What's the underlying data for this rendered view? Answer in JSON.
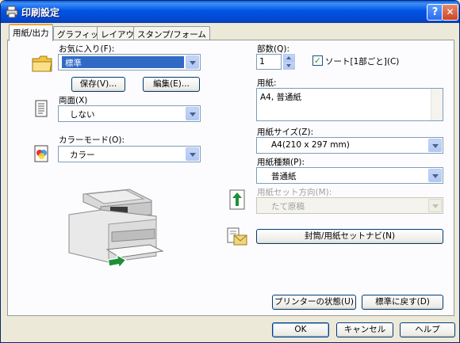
{
  "window": {
    "title": "印刷設定",
    "help": "?",
    "close": "✕"
  },
  "tabs": [
    {
      "label": "用紙/出力",
      "active": true
    },
    {
      "label": "グラフィックス",
      "active": false
    },
    {
      "label": "レイアウト",
      "active": false
    },
    {
      "label": "スタンプ/フォーム",
      "active": false
    }
  ],
  "left": {
    "favorites_label": "お気に入り(F):",
    "favorites_value": "標準",
    "save_button": "保存(V)...",
    "edit_button": "編集(E)...",
    "duplex_label": "両面(X)",
    "duplex_value": "しない",
    "color_mode_label": "カラーモード(O):",
    "color_mode_value": "カラー"
  },
  "right": {
    "copies_label": "部数(Q):",
    "copies_value": "1",
    "collate_label": "ソート[1部ごと](C)",
    "collate_checked": true,
    "paper_label": "用紙:",
    "paper_value": "A4, 普通紙",
    "paper_size_label": "用紙サイズ(Z):",
    "paper_size_value": "A4(210 x 297 mm)",
    "paper_type_label": "用紙種類(P):",
    "paper_type_value": "普通紙",
    "feed_direction_label": "用紙セット方向(M):",
    "feed_direction_value": "たて原稿",
    "envelope_button": "封筒/用紙セットナビ(N)"
  },
  "bottom": {
    "printer_status_button": "プリンターの状態(U)",
    "restore_defaults_button": "標準に戻す(D)",
    "ok_button": "OK",
    "cancel_button": "キャンセル",
    "help_button": "ヘルプ"
  },
  "colors": {
    "title_bar": "#0054e3",
    "selection": "#316ac5",
    "tab_highlight": "#f1a236",
    "arrow_green": "#1f8f3a"
  }
}
